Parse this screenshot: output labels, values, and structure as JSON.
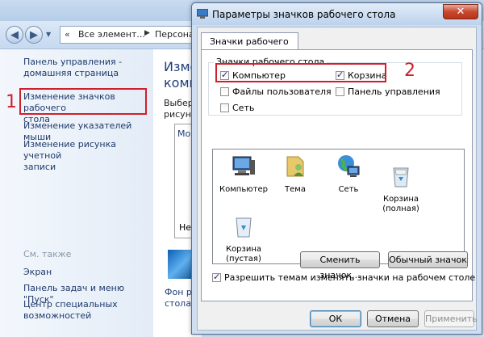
{
  "background_window": {
    "address": {
      "segment1": "Все элемент...",
      "segment2": "Персона"
    },
    "left_pane": {
      "home_link": "Панель управления -\nдомашняя страница",
      "links": [
        "Изменение значков рабочего\nстола",
        "Изменение указателей мыши",
        "Изменение рисунка учетной\nзаписи"
      ],
      "see_also_header": "См. также",
      "see_also": [
        "Экран",
        "Панель задач и меню \"Пуск\"",
        "Центр специальных\nвозможностей"
      ]
    },
    "main_pane": {
      "title": "Измене\nкомпь",
      "text": "Выбери\nрисунок",
      "box_label": "Мои",
      "ne_text": "Не",
      "fon_text": "Фон р\nстола"
    }
  },
  "annotations": {
    "marker1": "1",
    "marker2": "2",
    "accent_color": "#d01f2b"
  },
  "dialog": {
    "title": "Параметры значков рабочего стола",
    "close_symbol": "✕",
    "tab_label": "Значки рабочего стола",
    "group_title": "Значки рабочего стола",
    "checkboxes": [
      {
        "label": "Компьютер",
        "checked": true
      },
      {
        "label": "Корзина",
        "checked": true
      },
      {
        "label": "Файлы пользователя",
        "checked": false
      },
      {
        "label": "Панель управления",
        "checked": false
      },
      {
        "label": "Сеть",
        "checked": false
      }
    ],
    "icons": [
      {
        "label": "Компьютер",
        "icon": "computer-icon"
      },
      {
        "label": "Тема",
        "icon": "user-folder-icon"
      },
      {
        "label": "Сеть",
        "icon": "network-globe-icon"
      },
      {
        "label": "Корзина\n(полная)",
        "icon": "recycle-bin-full-icon"
      },
      {
        "label": "Корзина\n(пустая)",
        "icon": "recycle-bin-empty-icon"
      }
    ],
    "change_icon_button": "Сменить значок...",
    "default_icon_button": "Обычный значок",
    "allow_themes_label": "Разрешить темам изменять значки на рабочем столе",
    "allow_themes_checked": true,
    "ok_button": "ОК",
    "cancel_button": "Отмена",
    "apply_button": "Применить"
  }
}
